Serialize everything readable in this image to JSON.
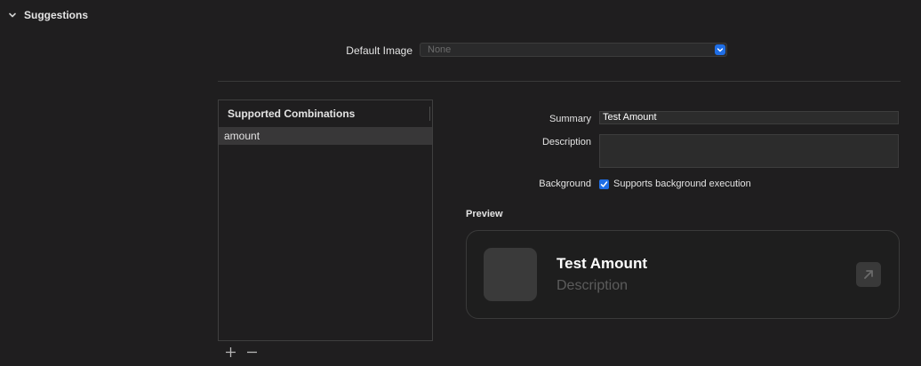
{
  "section": {
    "title": "Suggestions"
  },
  "default_image": {
    "label": "Default Image",
    "value": "None"
  },
  "supported_combinations": {
    "header": "Supported Combinations",
    "items": [
      "amount"
    ]
  },
  "form": {
    "summary_label": "Summary",
    "summary_value": "Test Amount",
    "description_label": "Description",
    "description_value": "",
    "background_label": "Background",
    "background_checkbox_label": "Supports background execution",
    "background_checked": true
  },
  "preview": {
    "title": "Preview",
    "name": "Test Amount",
    "description": "Description"
  },
  "colors": {
    "accent": "#1f6ee6",
    "background": "#1f1e1f"
  }
}
